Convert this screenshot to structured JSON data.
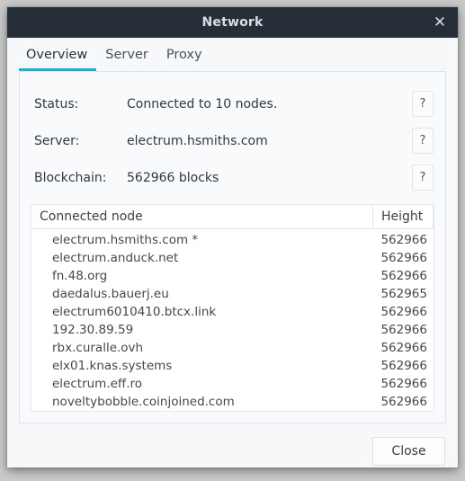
{
  "window": {
    "title": "Network",
    "close_icon": "close-icon",
    "close_glyph": "✕"
  },
  "tabs": [
    {
      "label": "Overview",
      "active": true
    },
    {
      "label": "Server",
      "active": false
    },
    {
      "label": "Proxy",
      "active": false
    }
  ],
  "overview": {
    "rows": [
      {
        "label": "Status:",
        "value": "Connected to 10 nodes.",
        "help": "?"
      },
      {
        "label": "Server:",
        "value": "electrum.hsmiths.com",
        "help": "?"
      },
      {
        "label": "Blockchain:",
        "value": "562966 blocks",
        "help": "?"
      }
    ]
  },
  "table": {
    "columns": [
      "Connected node",
      "Height"
    ],
    "rows": [
      {
        "node": "electrum.hsmiths.com *",
        "height": "562966"
      },
      {
        "node": "electrum.anduck.net",
        "height": "562966"
      },
      {
        "node": "fn.48.org",
        "height": "562966"
      },
      {
        "node": "daedalus.bauerj.eu",
        "height": "562965"
      },
      {
        "node": "electrum6010410.btcx.link",
        "height": "562966"
      },
      {
        "node": "192.30.89.59",
        "height": "562966"
      },
      {
        "node": "rbx.curalle.ovh",
        "height": "562966"
      },
      {
        "node": "elx01.knas.systems",
        "height": "562966"
      },
      {
        "node": "electrum.eff.ro",
        "height": "562966"
      },
      {
        "node": "noveltybobble.coinjoined.com",
        "height": "562966"
      }
    ]
  },
  "footer": {
    "close_label": "Close"
  },
  "colors": {
    "titlebar": "#262f38",
    "accent": "#17b3d4",
    "panel": "#f9fafb",
    "window": "#f7f8fa"
  }
}
